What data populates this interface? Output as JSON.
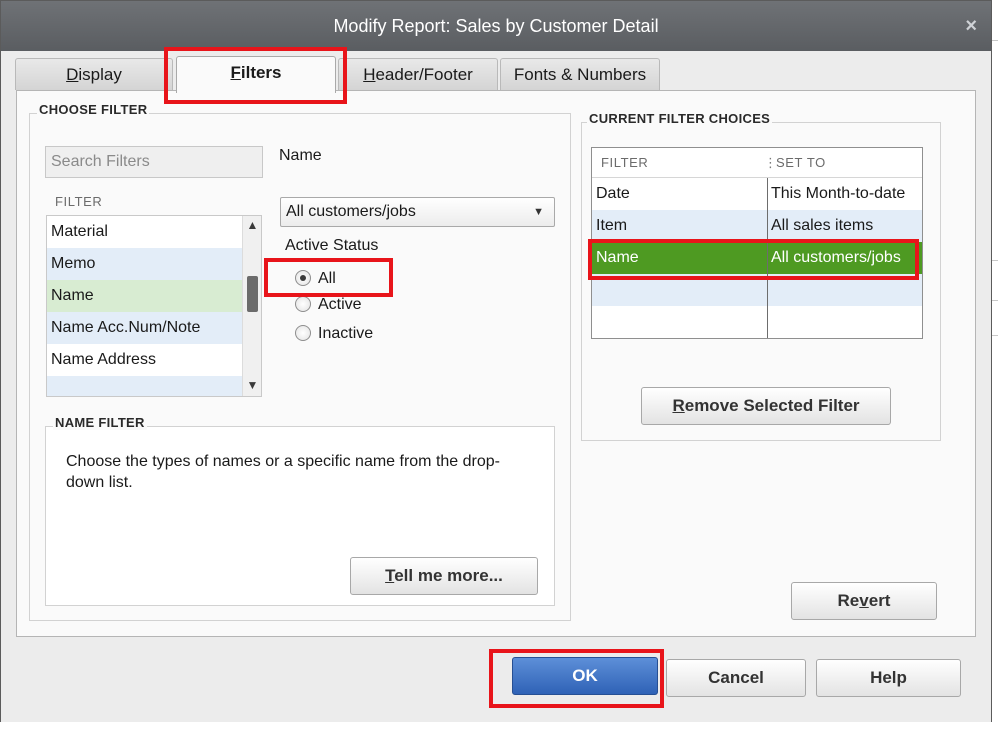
{
  "dialog": {
    "title": "Modify Report: Sales by Customer Detail",
    "close_glyph": "×"
  },
  "tabs": [
    {
      "key": "D",
      "rest": "isplay",
      "active": false
    },
    {
      "key": "F",
      "rest": "ilters",
      "active": true
    },
    {
      "key": "H",
      "rest": "eader/Footer",
      "active": false
    },
    {
      "label": "Fonts & Numbers",
      "active": false
    }
  ],
  "choose_filter": {
    "title": "CHOOSE FILTER",
    "search_placeholder": "Search Filters",
    "column_label": "FILTER",
    "items": [
      "Material",
      "Memo",
      "Name",
      "Name Acc.Num/Note",
      "Name Address"
    ],
    "selected": "Name"
  },
  "name_panel": {
    "label": "Name",
    "dropdown_value": "All customers/jobs",
    "status_label": "Active Status",
    "options": [
      "All",
      "Active",
      "Inactive"
    ],
    "selected_option": "All"
  },
  "name_filter": {
    "title": "NAME FILTER",
    "description": "Choose the types of names or a specific name from the drop-down list.",
    "tell_more_key": "T",
    "tell_more_rest": "ell me more..."
  },
  "current_filters": {
    "title": "CURRENT FILTER CHOICES",
    "col_filter": "FILTER",
    "col_set_to": "SET TO",
    "rows": [
      {
        "filter": "Date",
        "set_to": "This Month-to-date"
      },
      {
        "filter": "Item",
        "set_to": "All sales items"
      },
      {
        "filter": "Name",
        "set_to": "All customers/jobs"
      }
    ],
    "selected_row": "Name",
    "remove_key": "R",
    "remove_rest": "emove Selected Filter"
  },
  "buttons": {
    "revert_pre": "Re",
    "revert_key": "v",
    "revert_post": "ert",
    "ok": "OK",
    "cancel": "Cancel",
    "help": "Help"
  },
  "colors": {
    "highlight": "#e8141a",
    "selected_row": "#4e9a22",
    "primary_button": "#2f62b6"
  }
}
